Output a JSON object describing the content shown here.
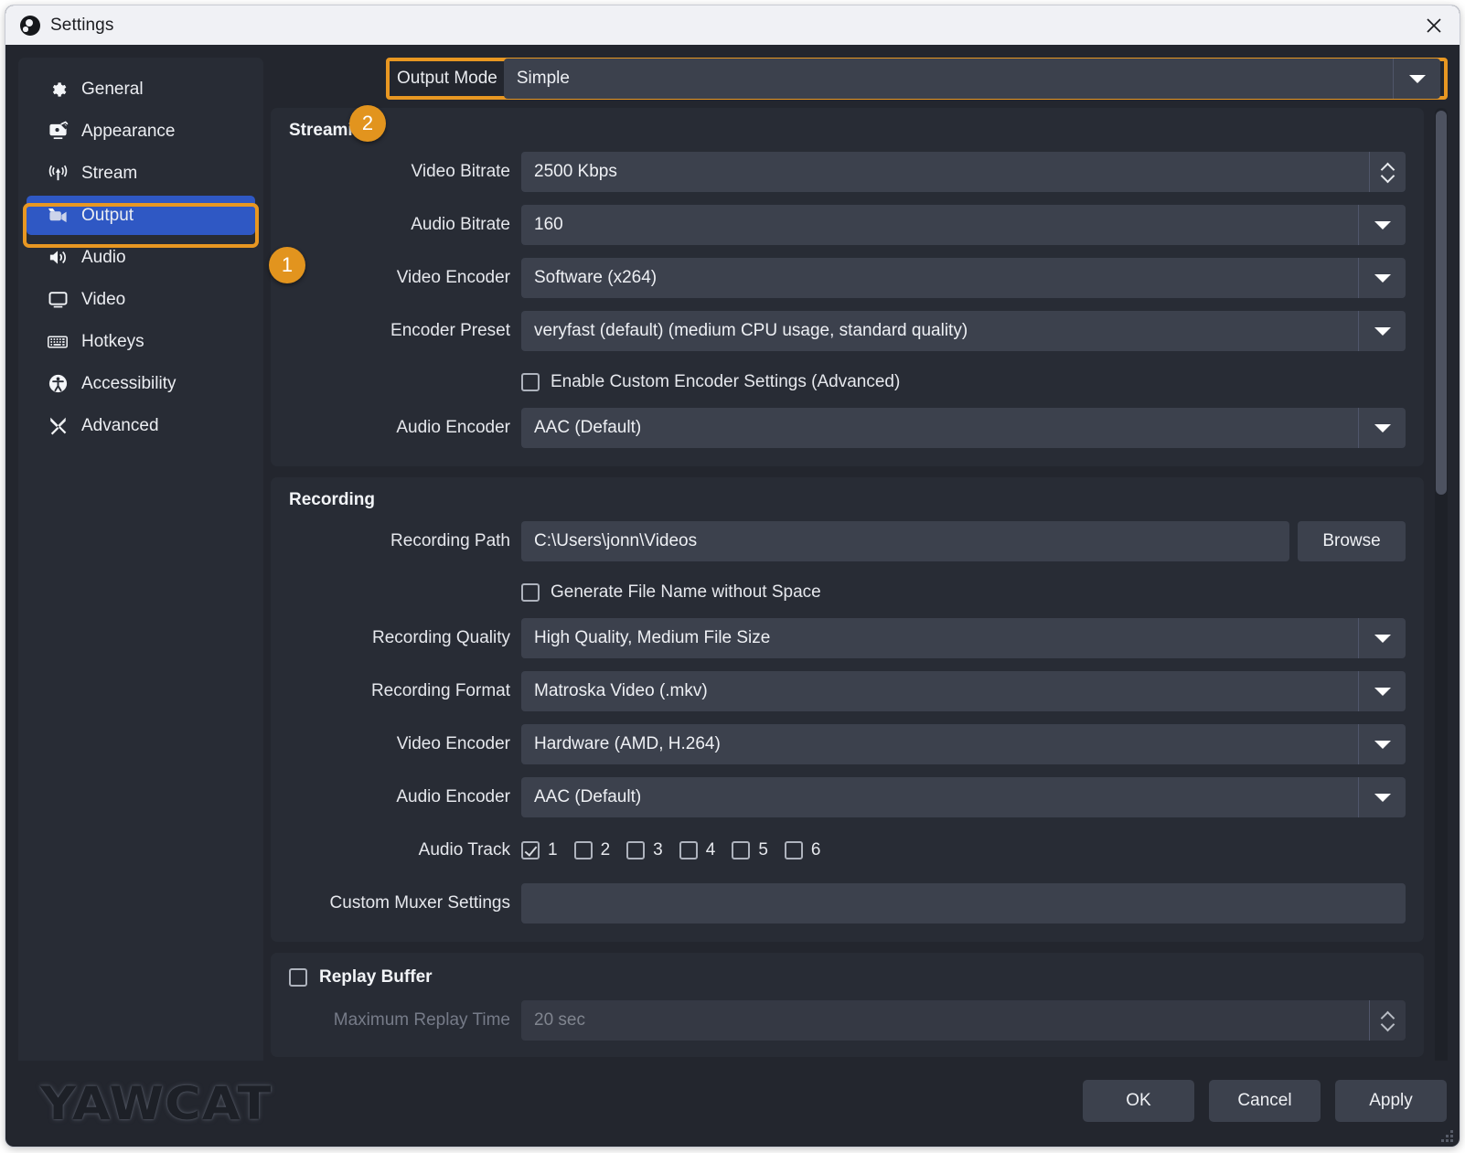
{
  "window": {
    "title": "Settings",
    "close_label": "✕",
    "logo_icon": "obs-logo-icon"
  },
  "colors": {
    "accent_orange": "#e89722",
    "selected_blue": "#2f58c4",
    "panel": "#282c35",
    "window_bg": "#23262e",
    "control": "#3c414d",
    "titlebar": "#f0f1f5"
  },
  "callouts": [
    {
      "number": "1",
      "target": "output-nav-item"
    },
    {
      "number": "2",
      "target": "output-mode-row"
    }
  ],
  "sidebar": {
    "items": [
      {
        "label": "General",
        "icon": "gear-icon",
        "selected": false
      },
      {
        "label": "Appearance",
        "icon": "appearance-icon",
        "selected": false
      },
      {
        "label": "Stream",
        "icon": "broadcast-icon",
        "selected": false
      },
      {
        "label": "Output",
        "icon": "output-camera-icon",
        "selected": true
      },
      {
        "label": "Audio",
        "icon": "speaker-icon",
        "selected": false
      },
      {
        "label": "Video",
        "icon": "monitor-icon",
        "selected": false
      },
      {
        "label": "Hotkeys",
        "icon": "keyboard-icon",
        "selected": false
      },
      {
        "label": "Accessibility",
        "icon": "accessibility-icon",
        "selected": false
      },
      {
        "label": "Advanced",
        "icon": "tools-icon",
        "selected": false
      }
    ]
  },
  "output_mode": {
    "label": "Output Mode",
    "value": "Simple"
  },
  "streaming": {
    "title": "Streaming",
    "video_bitrate": {
      "label": "Video Bitrate",
      "value": "2500 Kbps"
    },
    "audio_bitrate": {
      "label": "Audio Bitrate",
      "value": "160"
    },
    "video_encoder": {
      "label": "Video Encoder",
      "value": "Software (x264)"
    },
    "encoder_preset": {
      "label": "Encoder Preset",
      "value": "veryfast (default) (medium CPU usage, standard quality)"
    },
    "custom_encoder": {
      "label": "Enable Custom Encoder Settings (Advanced)",
      "checked": false
    },
    "audio_encoder": {
      "label": "Audio Encoder",
      "value": "AAC (Default)"
    }
  },
  "recording": {
    "title": "Recording",
    "recording_path": {
      "label": "Recording Path",
      "value": "C:\\Users\\jonn\\Videos"
    },
    "browse_label": "Browse",
    "generate_filename": {
      "label": "Generate File Name without Space",
      "checked": false
    },
    "recording_quality": {
      "label": "Recording Quality",
      "value": "High Quality, Medium File Size"
    },
    "recording_format": {
      "label": "Recording Format",
      "value": "Matroska Video (.mkv)"
    },
    "video_encoder": {
      "label": "Video Encoder",
      "value": "Hardware (AMD, H.264)"
    },
    "audio_encoder": {
      "label": "Audio Encoder",
      "value": "AAC (Default)"
    },
    "audio_track": {
      "label": "Audio Track",
      "tracks": [
        {
          "number": "1",
          "checked": true
        },
        {
          "number": "2",
          "checked": false
        },
        {
          "number": "3",
          "checked": false
        },
        {
          "number": "4",
          "checked": false
        },
        {
          "number": "5",
          "checked": false
        },
        {
          "number": "6",
          "checked": false
        }
      ]
    },
    "custom_muxer": {
      "label": "Custom Muxer Settings",
      "value": ""
    }
  },
  "replay_buffer": {
    "label": "Replay Buffer",
    "checked": false,
    "max_replay_time": {
      "label": "Maximum Replay Time",
      "value": "20 sec",
      "disabled": true
    }
  },
  "footer": {
    "ok": "OK",
    "cancel": "Cancel",
    "apply": "Apply"
  },
  "watermark": {
    "text": "YAWCAT"
  }
}
